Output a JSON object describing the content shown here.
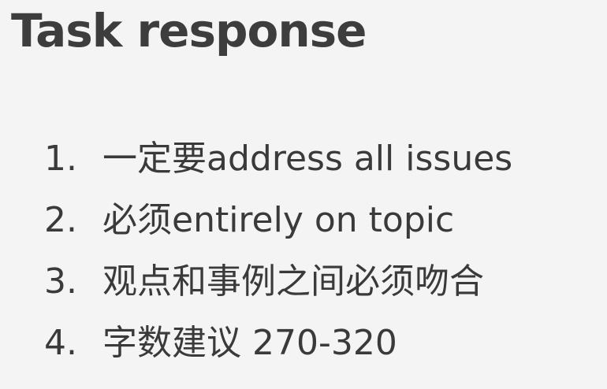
{
  "title": "Task response",
  "items": [
    {
      "number": "1.",
      "text": "一定要address all issues"
    },
    {
      "number": "2.",
      "text": "必须entirely on topic"
    },
    {
      "number": "3.",
      "text": "观点和事例之间必须吻合"
    },
    {
      "number": "4.",
      "text": "字数建议 270-320"
    }
  ]
}
